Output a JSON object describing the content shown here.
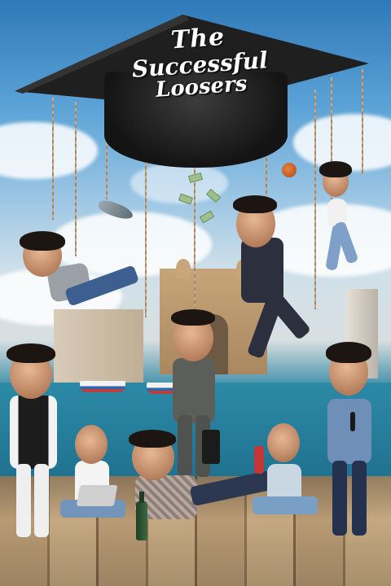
{
  "poster": {
    "title_line1": "The",
    "title_line2": "Successful",
    "title_line3": "Loosers"
  },
  "colors": {
    "sky": "#5aa2d6",
    "sea": "#2c8aa6",
    "deck": "#b89a74",
    "cap": "#1f1f1f",
    "title_text": "#ffffff"
  },
  "icons": [
    "graduation-cap",
    "basketball",
    "fish",
    "wine-bottle",
    "laptop",
    "briefcase",
    "microphone",
    "banknotes"
  ]
}
